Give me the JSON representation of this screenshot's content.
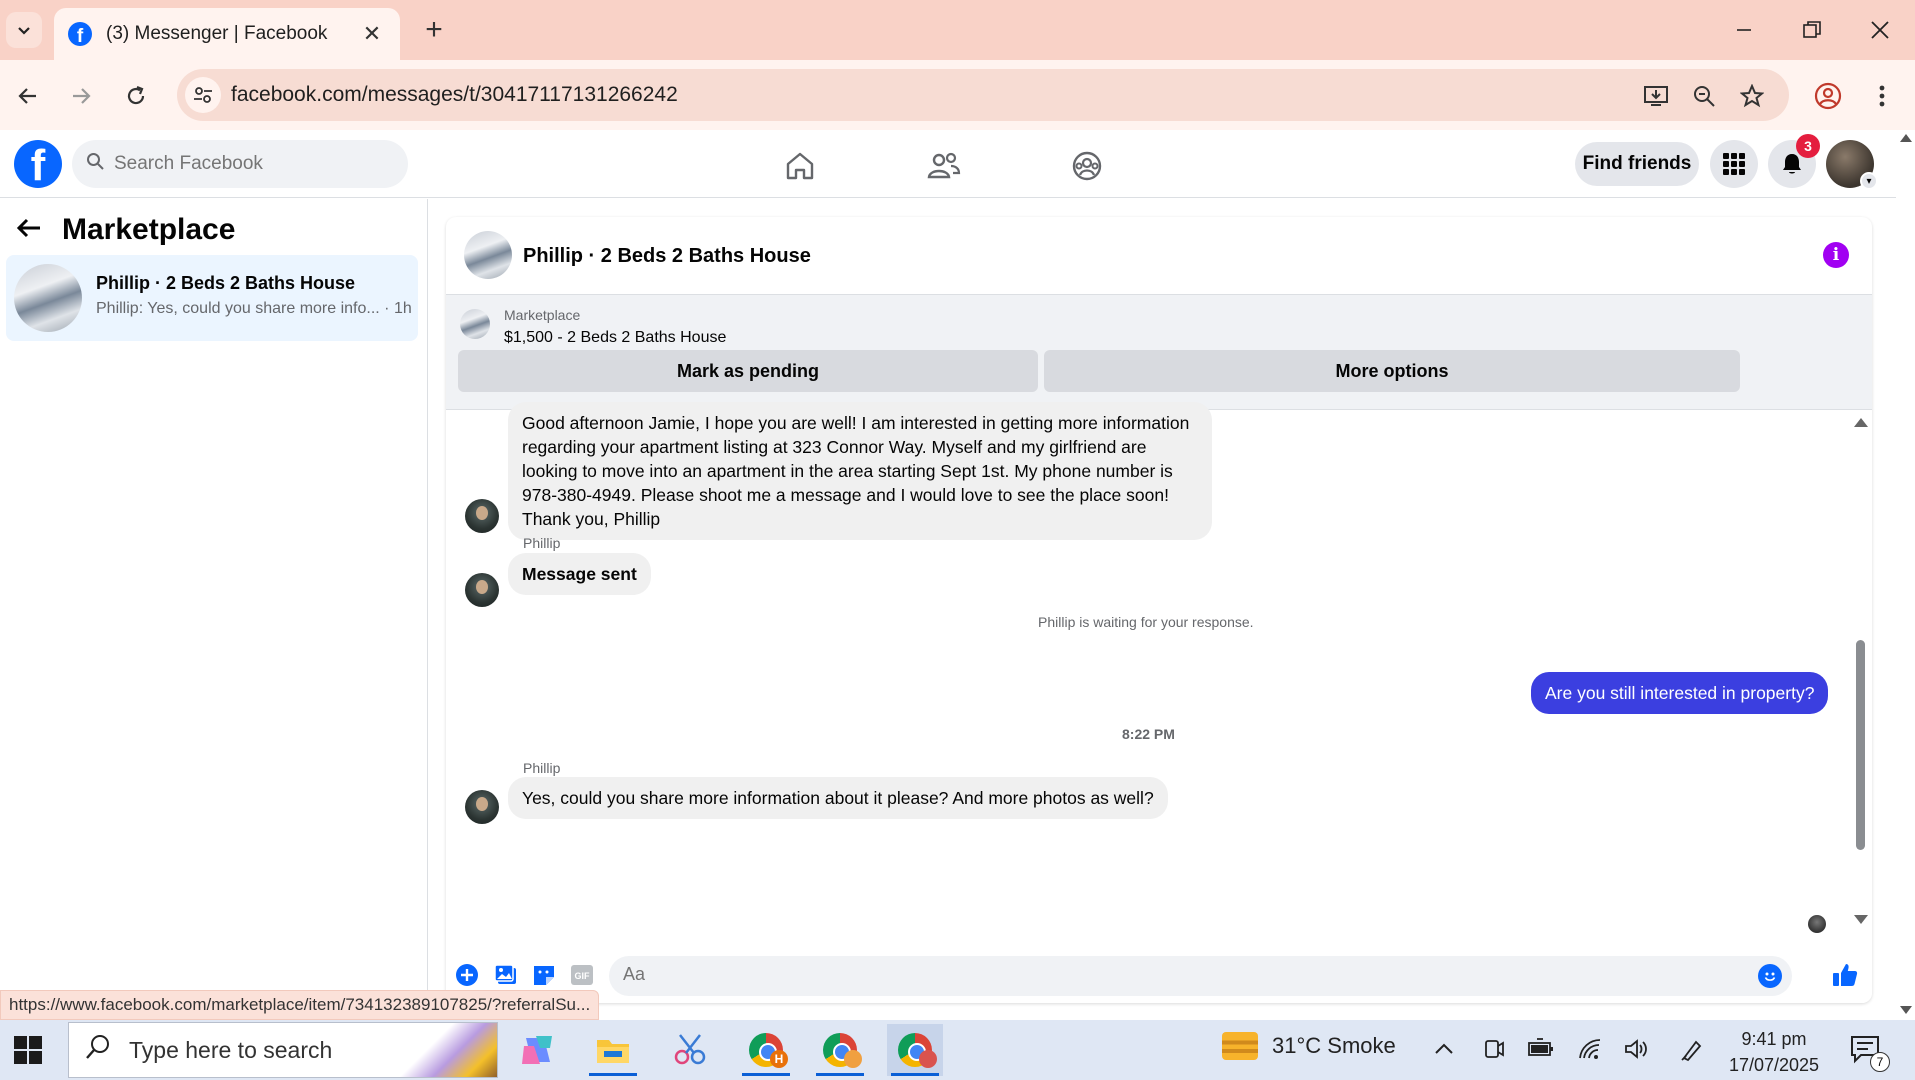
{
  "browser": {
    "tab_title": "(3) Messenger | Facebook",
    "url": "facebook.com/messages/t/30417117131266242",
    "status_url": "https://www.facebook.com/marketplace/item/734132389107825/?referralSu..."
  },
  "facebook": {
    "logo_letter": "f",
    "search_placeholder": "Search Facebook",
    "find_friends_label": "Find friends",
    "notification_count": "3"
  },
  "sidebar": {
    "heading": "Marketplace",
    "conversations": [
      {
        "name": "Phillip · 2 Beds 2 Baths House",
        "preview": "Phillip: Yes, could you share more info... · 1h"
      }
    ]
  },
  "chat": {
    "title": "Phillip · 2 Beds 2 Baths House",
    "listing_source": "Marketplace",
    "listing_item": "$1,500 - 2 Beds 2 Baths House",
    "mark_pending_label": "Mark as pending",
    "more_options_label": "More options",
    "messages": [
      {
        "text": "Good afternoon Jamie, I hope you are well! I am interested in getting more information regarding your apartment listing at 323 Connor Way. Myself and my girlfriend are looking to move into an apartment in the area starting Sept 1st. My phone number is 978-380-4949. Please shoot me a message and I would love to see the place soon! Thank you, Phillip"
      },
      {
        "sender": "Phillip",
        "text": "Message sent"
      },
      {
        "system": "Phillip is waiting for your response."
      },
      {
        "text": "Are you still interested in property?"
      },
      {
        "timestamp": "8:22 PM"
      },
      {
        "sender": "Phillip",
        "text": "Yes, could you share more information about it please? And more photos as well?"
      }
    ],
    "composer_placeholder": "Aa"
  },
  "taskbar": {
    "search_placeholder": "Type here to search",
    "weather": "31°C  Smoke",
    "time": "9:41 pm",
    "date": "17/07/2025",
    "notification_count": "7",
    "chrome_profile_letter": "H"
  },
  "colors": {
    "facebook_blue": "#0866ff",
    "outgoing_bubble": "#3b3fe0",
    "info_icon": "#a100f2",
    "badge_red": "#e41e3f"
  }
}
